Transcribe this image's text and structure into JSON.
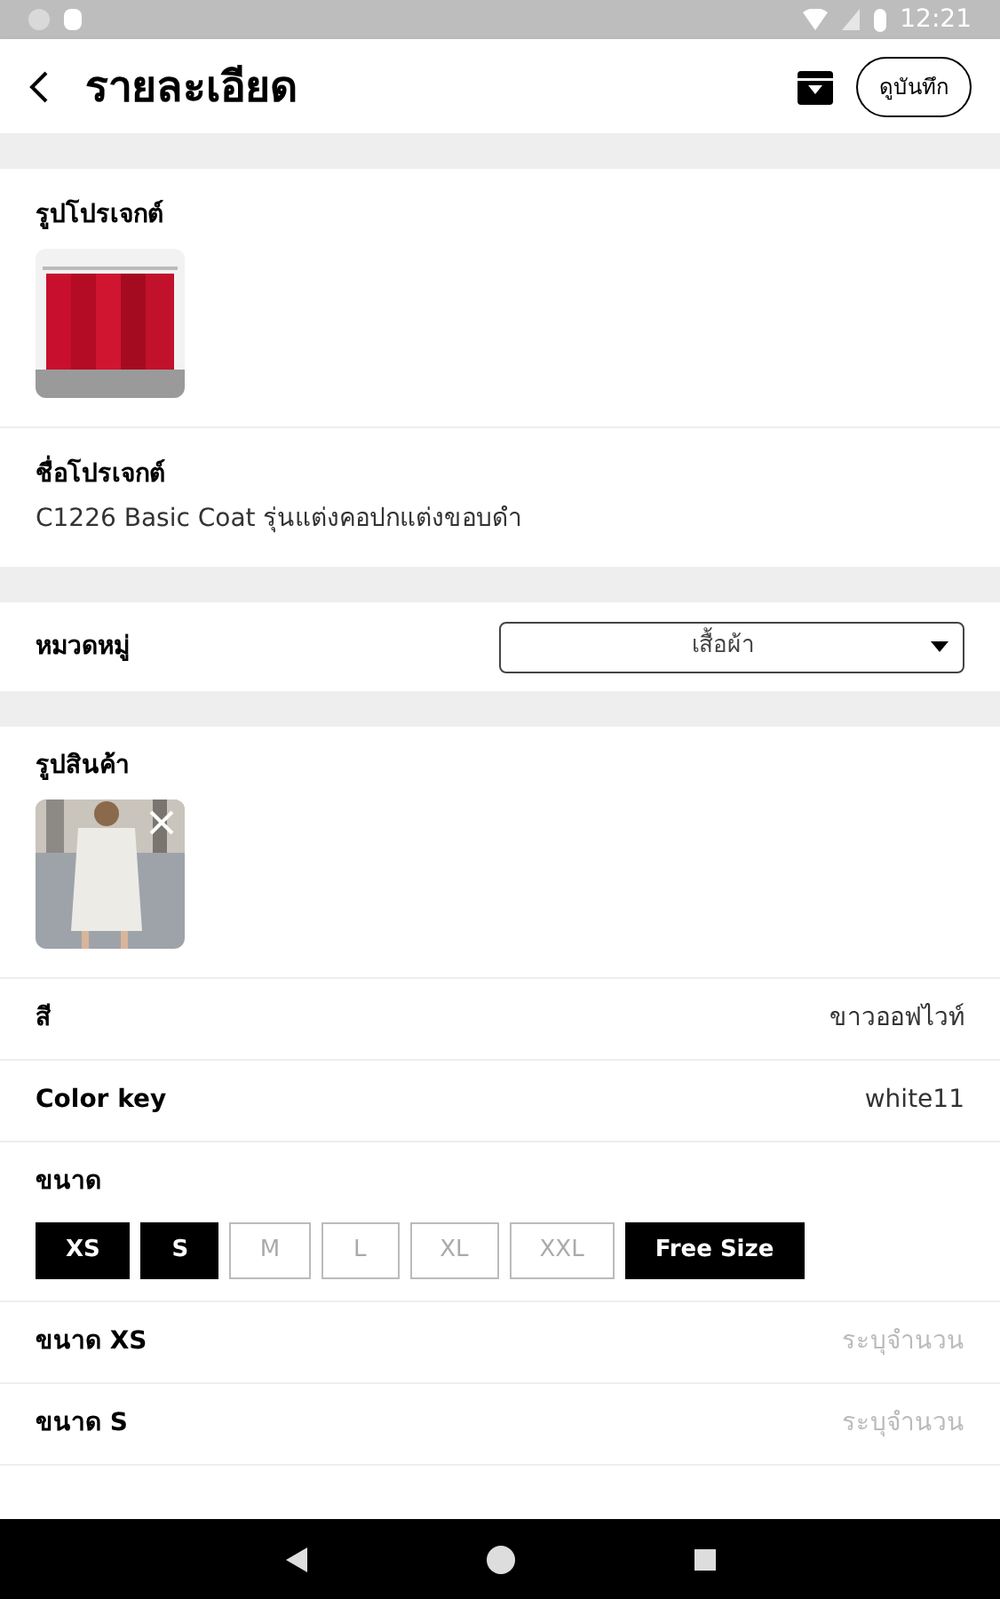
{
  "status_bar": {
    "time": "12:21"
  },
  "header": {
    "title": "รายละเอียด",
    "saved_button": "ดูบันทึก"
  },
  "project_image": {
    "label": "รูปโปรเจกต์"
  },
  "project_name": {
    "label": "ชื่อโปรเจกต์",
    "value": "C1226 Basic Coat รุ่นแต่งคอปกแต่งขอบดำ"
  },
  "category": {
    "label": "หมวดหมู่",
    "value": "เสื้อผ้า"
  },
  "product_image": {
    "label": "รูปสินค้า"
  },
  "color": {
    "label": "สี",
    "value": "ขาวออฟไวท์"
  },
  "color_key": {
    "label": "Color key",
    "value": "white11"
  },
  "size": {
    "label": "ขนาด",
    "options": [
      {
        "label": "XS",
        "selected": true
      },
      {
        "label": "S",
        "selected": true
      },
      {
        "label": "M",
        "selected": false
      },
      {
        "label": "L",
        "selected": false
      },
      {
        "label": "XL",
        "selected": false
      },
      {
        "label": "XXL",
        "selected": false
      },
      {
        "label": "Free Size",
        "selected": true
      }
    ]
  },
  "quantities": [
    {
      "label": "ขนาด XS",
      "placeholder": "ระบุจำนวน"
    },
    {
      "label": "ขนาด S",
      "placeholder": "ระบุจำนวน"
    }
  ]
}
